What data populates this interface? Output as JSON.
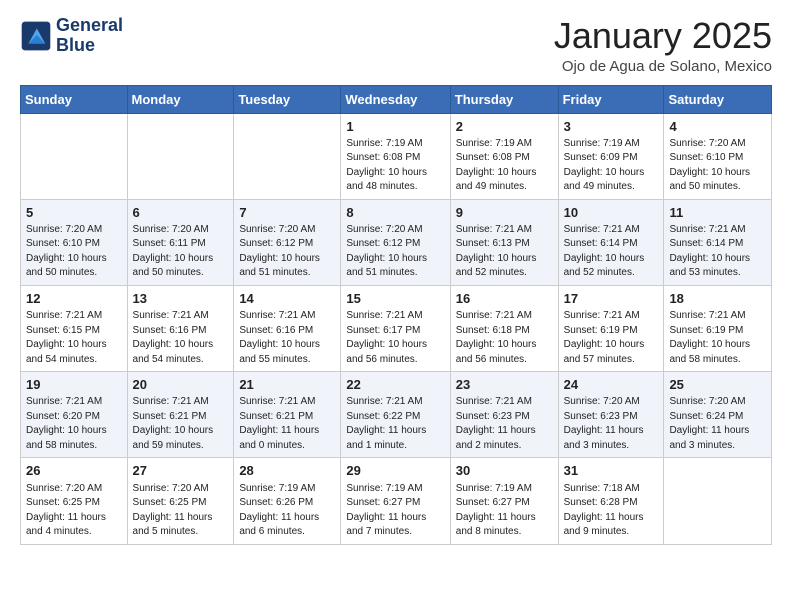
{
  "header": {
    "logo_line1": "General",
    "logo_line2": "Blue",
    "month": "January 2025",
    "location": "Ojo de Agua de Solano, Mexico"
  },
  "days_of_week": [
    "Sunday",
    "Monday",
    "Tuesday",
    "Wednesday",
    "Thursday",
    "Friday",
    "Saturday"
  ],
  "weeks": [
    [
      {
        "num": "",
        "info": ""
      },
      {
        "num": "",
        "info": ""
      },
      {
        "num": "",
        "info": ""
      },
      {
        "num": "1",
        "info": "Sunrise: 7:19 AM\nSunset: 6:08 PM\nDaylight: 10 hours\nand 48 minutes."
      },
      {
        "num": "2",
        "info": "Sunrise: 7:19 AM\nSunset: 6:08 PM\nDaylight: 10 hours\nand 49 minutes."
      },
      {
        "num": "3",
        "info": "Sunrise: 7:19 AM\nSunset: 6:09 PM\nDaylight: 10 hours\nand 49 minutes."
      },
      {
        "num": "4",
        "info": "Sunrise: 7:20 AM\nSunset: 6:10 PM\nDaylight: 10 hours\nand 50 minutes."
      }
    ],
    [
      {
        "num": "5",
        "info": "Sunrise: 7:20 AM\nSunset: 6:10 PM\nDaylight: 10 hours\nand 50 minutes."
      },
      {
        "num": "6",
        "info": "Sunrise: 7:20 AM\nSunset: 6:11 PM\nDaylight: 10 hours\nand 50 minutes."
      },
      {
        "num": "7",
        "info": "Sunrise: 7:20 AM\nSunset: 6:12 PM\nDaylight: 10 hours\nand 51 minutes."
      },
      {
        "num": "8",
        "info": "Sunrise: 7:20 AM\nSunset: 6:12 PM\nDaylight: 10 hours\nand 51 minutes."
      },
      {
        "num": "9",
        "info": "Sunrise: 7:21 AM\nSunset: 6:13 PM\nDaylight: 10 hours\nand 52 minutes."
      },
      {
        "num": "10",
        "info": "Sunrise: 7:21 AM\nSunset: 6:14 PM\nDaylight: 10 hours\nand 52 minutes."
      },
      {
        "num": "11",
        "info": "Sunrise: 7:21 AM\nSunset: 6:14 PM\nDaylight: 10 hours\nand 53 minutes."
      }
    ],
    [
      {
        "num": "12",
        "info": "Sunrise: 7:21 AM\nSunset: 6:15 PM\nDaylight: 10 hours\nand 54 minutes."
      },
      {
        "num": "13",
        "info": "Sunrise: 7:21 AM\nSunset: 6:16 PM\nDaylight: 10 hours\nand 54 minutes."
      },
      {
        "num": "14",
        "info": "Sunrise: 7:21 AM\nSunset: 6:16 PM\nDaylight: 10 hours\nand 55 minutes."
      },
      {
        "num": "15",
        "info": "Sunrise: 7:21 AM\nSunset: 6:17 PM\nDaylight: 10 hours\nand 56 minutes."
      },
      {
        "num": "16",
        "info": "Sunrise: 7:21 AM\nSunset: 6:18 PM\nDaylight: 10 hours\nand 56 minutes."
      },
      {
        "num": "17",
        "info": "Sunrise: 7:21 AM\nSunset: 6:19 PM\nDaylight: 10 hours\nand 57 minutes."
      },
      {
        "num": "18",
        "info": "Sunrise: 7:21 AM\nSunset: 6:19 PM\nDaylight: 10 hours\nand 58 minutes."
      }
    ],
    [
      {
        "num": "19",
        "info": "Sunrise: 7:21 AM\nSunset: 6:20 PM\nDaylight: 10 hours\nand 58 minutes."
      },
      {
        "num": "20",
        "info": "Sunrise: 7:21 AM\nSunset: 6:21 PM\nDaylight: 10 hours\nand 59 minutes."
      },
      {
        "num": "21",
        "info": "Sunrise: 7:21 AM\nSunset: 6:21 PM\nDaylight: 11 hours\nand 0 minutes."
      },
      {
        "num": "22",
        "info": "Sunrise: 7:21 AM\nSunset: 6:22 PM\nDaylight: 11 hours\nand 1 minute."
      },
      {
        "num": "23",
        "info": "Sunrise: 7:21 AM\nSunset: 6:23 PM\nDaylight: 11 hours\nand 2 minutes."
      },
      {
        "num": "24",
        "info": "Sunrise: 7:20 AM\nSunset: 6:23 PM\nDaylight: 11 hours\nand 3 minutes."
      },
      {
        "num": "25",
        "info": "Sunrise: 7:20 AM\nSunset: 6:24 PM\nDaylight: 11 hours\nand 3 minutes."
      }
    ],
    [
      {
        "num": "26",
        "info": "Sunrise: 7:20 AM\nSunset: 6:25 PM\nDaylight: 11 hours\nand 4 minutes."
      },
      {
        "num": "27",
        "info": "Sunrise: 7:20 AM\nSunset: 6:25 PM\nDaylight: 11 hours\nand 5 minutes."
      },
      {
        "num": "28",
        "info": "Sunrise: 7:19 AM\nSunset: 6:26 PM\nDaylight: 11 hours\nand 6 minutes."
      },
      {
        "num": "29",
        "info": "Sunrise: 7:19 AM\nSunset: 6:27 PM\nDaylight: 11 hours\nand 7 minutes."
      },
      {
        "num": "30",
        "info": "Sunrise: 7:19 AM\nSunset: 6:27 PM\nDaylight: 11 hours\nand 8 minutes."
      },
      {
        "num": "31",
        "info": "Sunrise: 7:18 AM\nSunset: 6:28 PM\nDaylight: 11 hours\nand 9 minutes."
      },
      {
        "num": "",
        "info": ""
      }
    ]
  ]
}
